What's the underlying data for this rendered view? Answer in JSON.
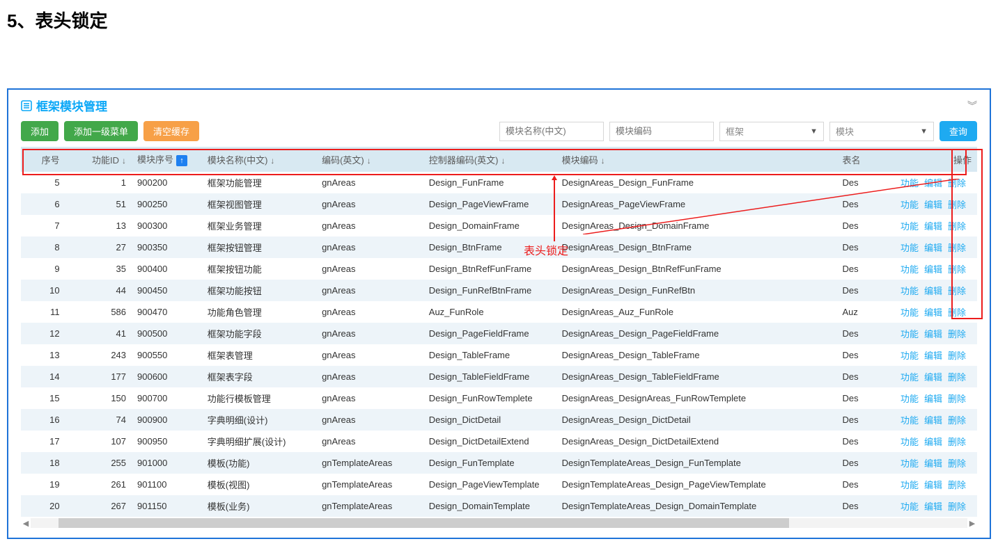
{
  "heading": "5、表头锁定",
  "panel": {
    "title": "框架模块管理"
  },
  "buttons": {
    "add": "添加",
    "add_menu": "添加一级菜单",
    "clear_cache": "清空缓存",
    "search": "查询"
  },
  "filters": {
    "name_ph": "模块名称(中文)",
    "code_ph": "模块编码",
    "select1": "框架",
    "select2": "模块"
  },
  "columns": {
    "seq": "序号",
    "funid": "功能ID",
    "modseq": "模块序号",
    "name": "模块名称(中文)",
    "encode": "编码(英文)",
    "ctrl": "控制器编码(英文)",
    "modcode": "模块编码",
    "table": "表名",
    "ops": "操作"
  },
  "actions": {
    "func": "功能",
    "edit": "编辑",
    "del": "删除"
  },
  "annotation": "表头锁定",
  "rows": [
    {
      "seq": "5",
      "funid": "1",
      "modseq": "900200",
      "name": "框架功能管理",
      "encode": "gnAreas",
      "ctrl": "Design_FunFrame",
      "modcode": "DesignAreas_Design_FunFrame",
      "table": "Des"
    },
    {
      "seq": "6",
      "funid": "51",
      "modseq": "900250",
      "name": "框架视图管理",
      "encode": "gnAreas",
      "ctrl": "Design_PageViewFrame",
      "modcode": "DesignAreas_PageViewFrame",
      "table": "Des"
    },
    {
      "seq": "7",
      "funid": "13",
      "modseq": "900300",
      "name": "框架业务管理",
      "encode": "gnAreas",
      "ctrl": "Design_DomainFrame",
      "modcode": "DesignAreas_Design_DomainFrame",
      "table": "Des"
    },
    {
      "seq": "8",
      "funid": "27",
      "modseq": "900350",
      "name": "框架按钮管理",
      "encode": "gnAreas",
      "ctrl": "Design_BtnFrame",
      "modcode": "DesignAreas_Design_BtnFrame",
      "table": "Des"
    },
    {
      "seq": "9",
      "funid": "35",
      "modseq": "900400",
      "name": "框架按钮功能",
      "encode": "gnAreas",
      "ctrl": "Design_BtnRefFunFrame",
      "modcode": "DesignAreas_Design_BtnRefFunFrame",
      "table": "Des"
    },
    {
      "seq": "10",
      "funid": "44",
      "modseq": "900450",
      "name": "框架功能按钮",
      "encode": "gnAreas",
      "ctrl": "Design_FunRefBtnFrame",
      "modcode": "DesignAreas_Design_FunRefBtn",
      "table": "Des"
    },
    {
      "seq": "11",
      "funid": "586",
      "modseq": "900470",
      "name": "功能角色管理",
      "encode": "gnAreas",
      "ctrl": "Auz_FunRole",
      "modcode": "DesignAreas_Auz_FunRole",
      "table": "Auz"
    },
    {
      "seq": "12",
      "funid": "41",
      "modseq": "900500",
      "name": "框架功能字段",
      "encode": "gnAreas",
      "ctrl": "Design_PageFieldFrame",
      "modcode": "DesignAreas_Design_PageFieldFrame",
      "table": "Des"
    },
    {
      "seq": "13",
      "funid": "243",
      "modseq": "900550",
      "name": "框架表管理",
      "encode": "gnAreas",
      "ctrl": "Design_TableFrame",
      "modcode": "DesignAreas_Design_TableFrame",
      "table": "Des"
    },
    {
      "seq": "14",
      "funid": "177",
      "modseq": "900600",
      "name": "框架表字段",
      "encode": "gnAreas",
      "ctrl": "Design_TableFieldFrame",
      "modcode": "DesignAreas_Design_TableFieldFrame",
      "table": "Des"
    },
    {
      "seq": "15",
      "funid": "150",
      "modseq": "900700",
      "name": "功能行模板管理",
      "encode": "gnAreas",
      "ctrl": "Design_FunRowTemplete",
      "modcode": "DesignAreas_DesignAreas_FunRowTemplete",
      "table": "Des"
    },
    {
      "seq": "16",
      "funid": "74",
      "modseq": "900900",
      "name": "字典明细(设计)",
      "encode": "gnAreas",
      "ctrl": "Design_DictDetail",
      "modcode": "DesignAreas_Design_DictDetail",
      "table": "Des"
    },
    {
      "seq": "17",
      "funid": "107",
      "modseq": "900950",
      "name": "字典明细扩展(设计)",
      "encode": "gnAreas",
      "ctrl": "Design_DictDetailExtend",
      "modcode": "DesignAreas_Design_DictDetailExtend",
      "table": "Des"
    },
    {
      "seq": "18",
      "funid": "255",
      "modseq": "901000",
      "name": "模板(功能)",
      "encode": "gnTemplateAreas",
      "ctrl": "Design_FunTemplate",
      "modcode": "DesignTemplateAreas_Design_FunTemplate",
      "table": "Des"
    },
    {
      "seq": "19",
      "funid": "261",
      "modseq": "901100",
      "name": "模板(视图)",
      "encode": "gnTemplateAreas",
      "ctrl": "Design_PageViewTemplate",
      "modcode": "DesignTemplateAreas_Design_PageViewTemplate",
      "table": "Des"
    },
    {
      "seq": "20",
      "funid": "267",
      "modseq": "901150",
      "name": "模板(业务)",
      "encode": "gnTemplateAreas",
      "ctrl": "Design_DomainTemplate",
      "modcode": "DesignTemplateAreas_Design_DomainTemplate",
      "table": "Des"
    }
  ]
}
